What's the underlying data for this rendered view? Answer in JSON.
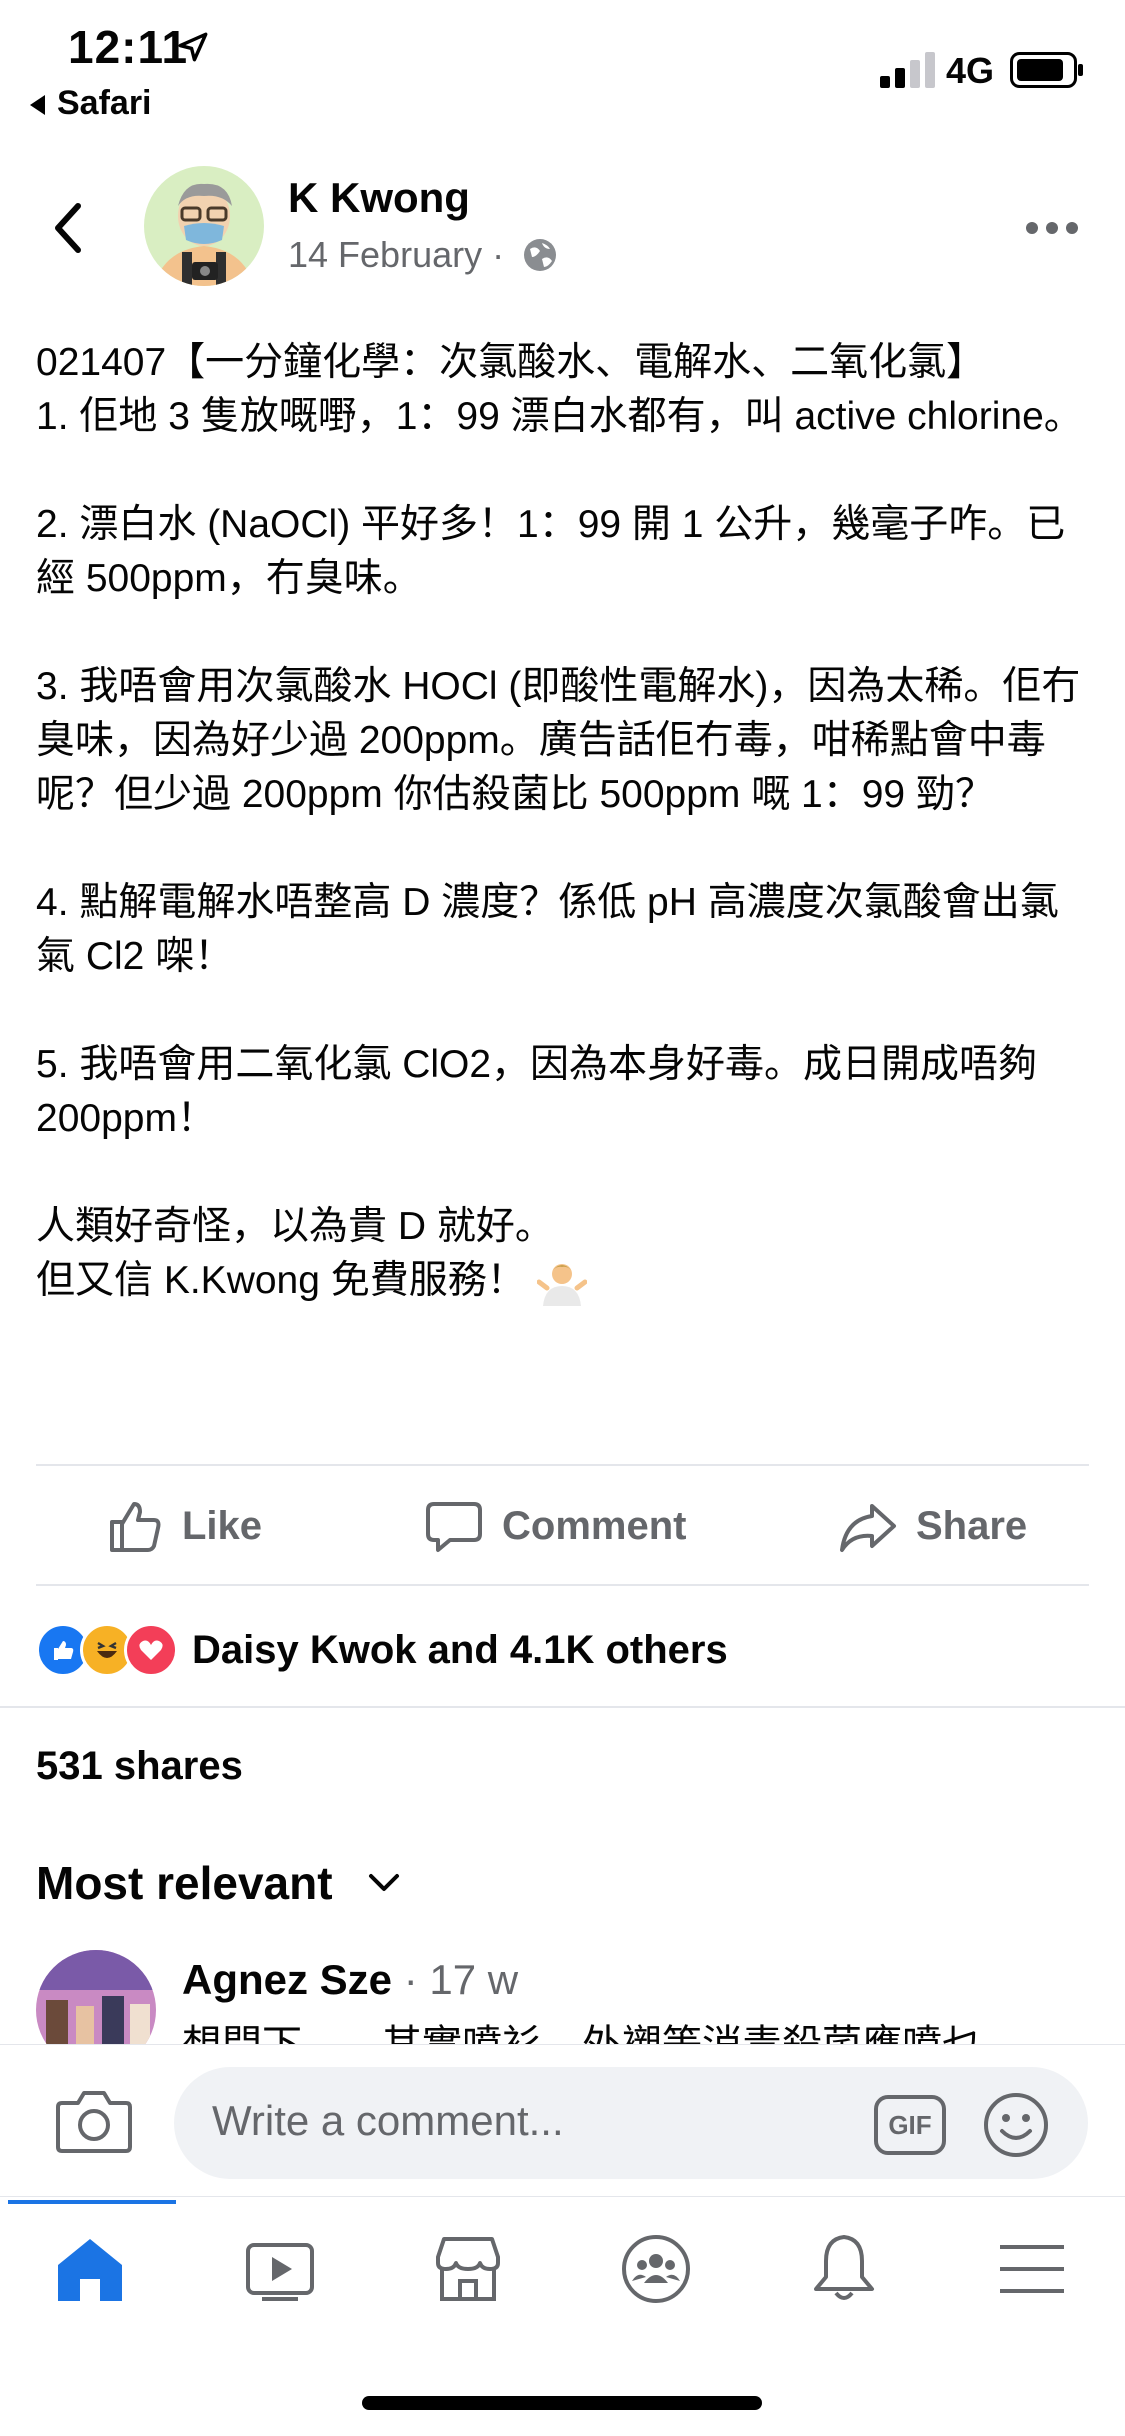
{
  "status_bar": {
    "time": "12:11",
    "back_app": "Safari",
    "network": "4G"
  },
  "post": {
    "author": "K Kwong",
    "date": "14 February",
    "meta_separator": "·",
    "paragraphs": [
      "021407【一分鐘化學：次氯酸水、電解水、二氧化氯】\n1. 佢地 3 隻放嘅嘢，1：99 漂白水都有，叫 active chlorine。",
      "2. 漂白水 (NaOCl) 平好多！1：99 開 1 公升，幾毫子咋。已經 500ppm，冇臭味。",
      "3. 我唔會用次氯酸水 HOCl (即酸性電解水)，因為太稀。佢冇臭味，因為好少過 200ppm。廣告話佢冇毒，咁稀點會中毒呢？但少過 200ppm 你估殺菌比 500ppm 嘅 1：99 勁？",
      "4. 點解電解水唔整高 D 濃度？係低 pH 高濃度次氯酸會出氯氣 Cl2 㗎！",
      "5. 我唔會用二氧化氯 ClO2，因為本身好毒。成日開成唔夠 200ppm！"
    ],
    "closing_line1": "人類好奇怪，以為貴 D 就好。",
    "closing_line2": "但又信 K.Kwong 免費服務！"
  },
  "actions": {
    "like": "Like",
    "comment": "Comment",
    "share": "Share"
  },
  "reactions": {
    "summary": "Daisy Kwok and 4.1K others"
  },
  "shares": "531 shares",
  "sort": {
    "label": "Most relevant"
  },
  "comment_preview": {
    "name": "Agnez Sze",
    "time": "· 17 w",
    "text": "想問下……其實噴衫，外襯等消毒殺菌應噴乜"
  },
  "composer": {
    "placeholder": "Write a comment...",
    "gif_label": "GIF"
  },
  "colors": {
    "accent": "#1b74e4",
    "secondary_text": "#65676b",
    "like_blue": "#1877f2",
    "love_red": "#f33e58",
    "haha_yellow": "#f7b125"
  }
}
